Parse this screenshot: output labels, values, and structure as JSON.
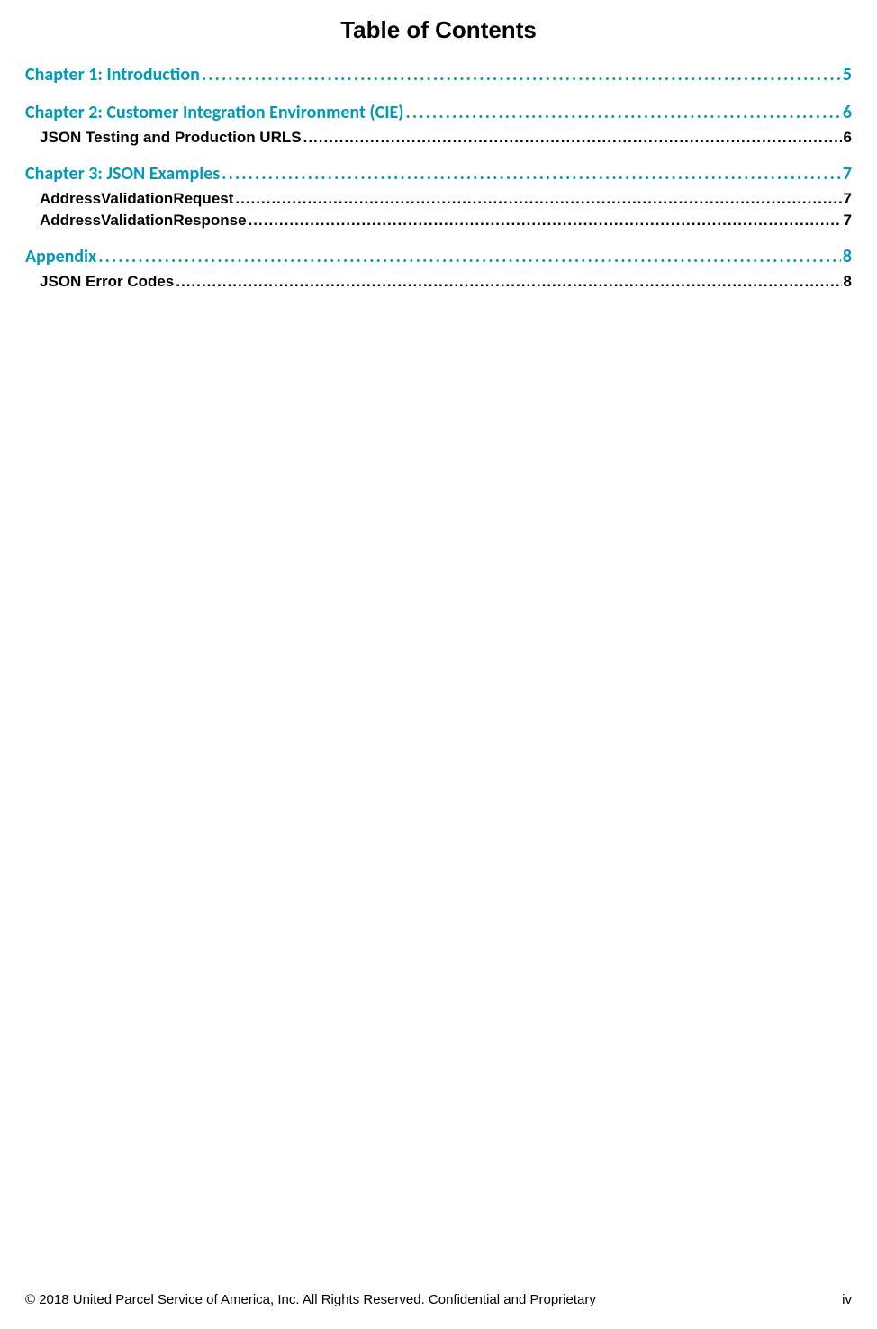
{
  "title": "Table of Contents",
  "toc": [
    {
      "level": 1,
      "label": "Chapter 1: Introduction",
      "page": "5"
    },
    {
      "level": 1,
      "label": "Chapter 2: Customer Integration Environment (CIE)",
      "page": "6"
    },
    {
      "level": 2,
      "label": "JSON Testing and Production URLS",
      "page": "6"
    },
    {
      "level": 1,
      "label": "Chapter 3: JSON Examples",
      "page": "7"
    },
    {
      "level": 2,
      "label": "AddressValidationRequest",
      "page": "7"
    },
    {
      "level": 2,
      "label": "AddressValidationResponse",
      "page": "7"
    },
    {
      "level": 1,
      "label": "Appendix",
      "page": "8"
    },
    {
      "level": 2,
      "label": "JSON Error Codes",
      "page": "8"
    }
  ],
  "footer": {
    "copyright": "© 2018 United Parcel Service of America, Inc. All Rights Reserved. Confidential and Proprietary",
    "page_number": "iv"
  }
}
